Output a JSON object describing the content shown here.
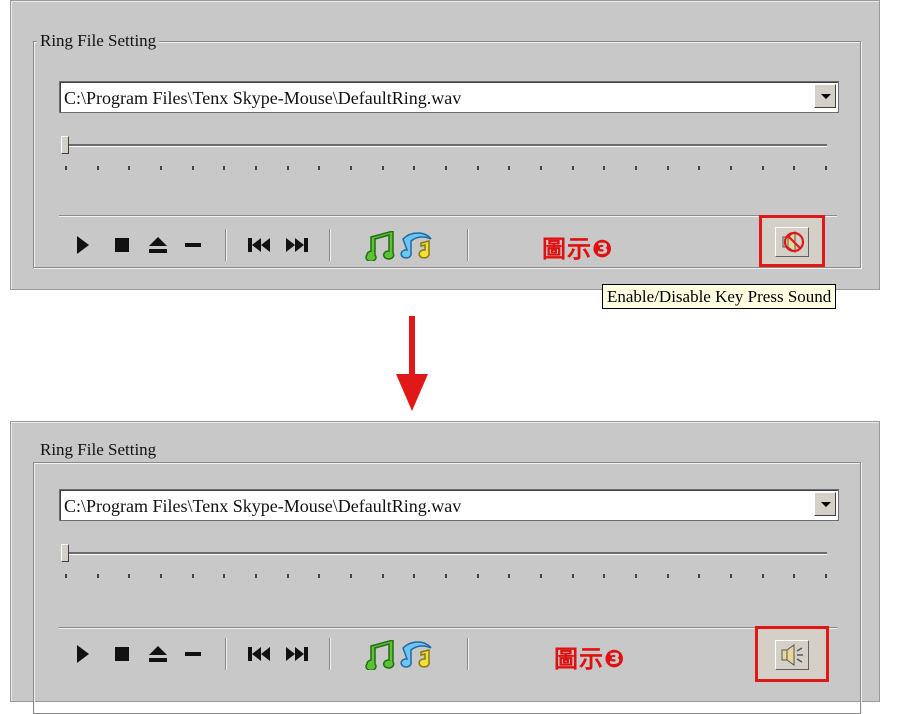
{
  "top_panel": {
    "group_title": "Ring File Setting",
    "file_path": "C:\\Program Files\\Tenx Skype-Mouse\\DefaultRing.wav",
    "annotation": "圖示❸",
    "tooltip": "Enable/Disable Key Press Sound",
    "speaker_state": "muted-speaker-icon"
  },
  "bottom_panel": {
    "group_title": "Ring File Setting",
    "file_path": "C:\\Program Files\\Tenx Skype-Mouse\\DefaultRing.wav",
    "annotation": "圖示❸",
    "speaker_state": "speaker-on-icon"
  },
  "toolbar": {
    "buttons": [
      "play-icon",
      "stop-icon",
      "eject-icon",
      "minus-icon",
      "previous-track-icon",
      "next-track-icon",
      "green-music-notes-icon",
      "blue-music-notes-icon"
    ]
  },
  "colors": {
    "highlight": "#e01818",
    "annotation_text": "#e01010",
    "arrow": "#e01818",
    "panel_bg": "#c8c8c8"
  }
}
